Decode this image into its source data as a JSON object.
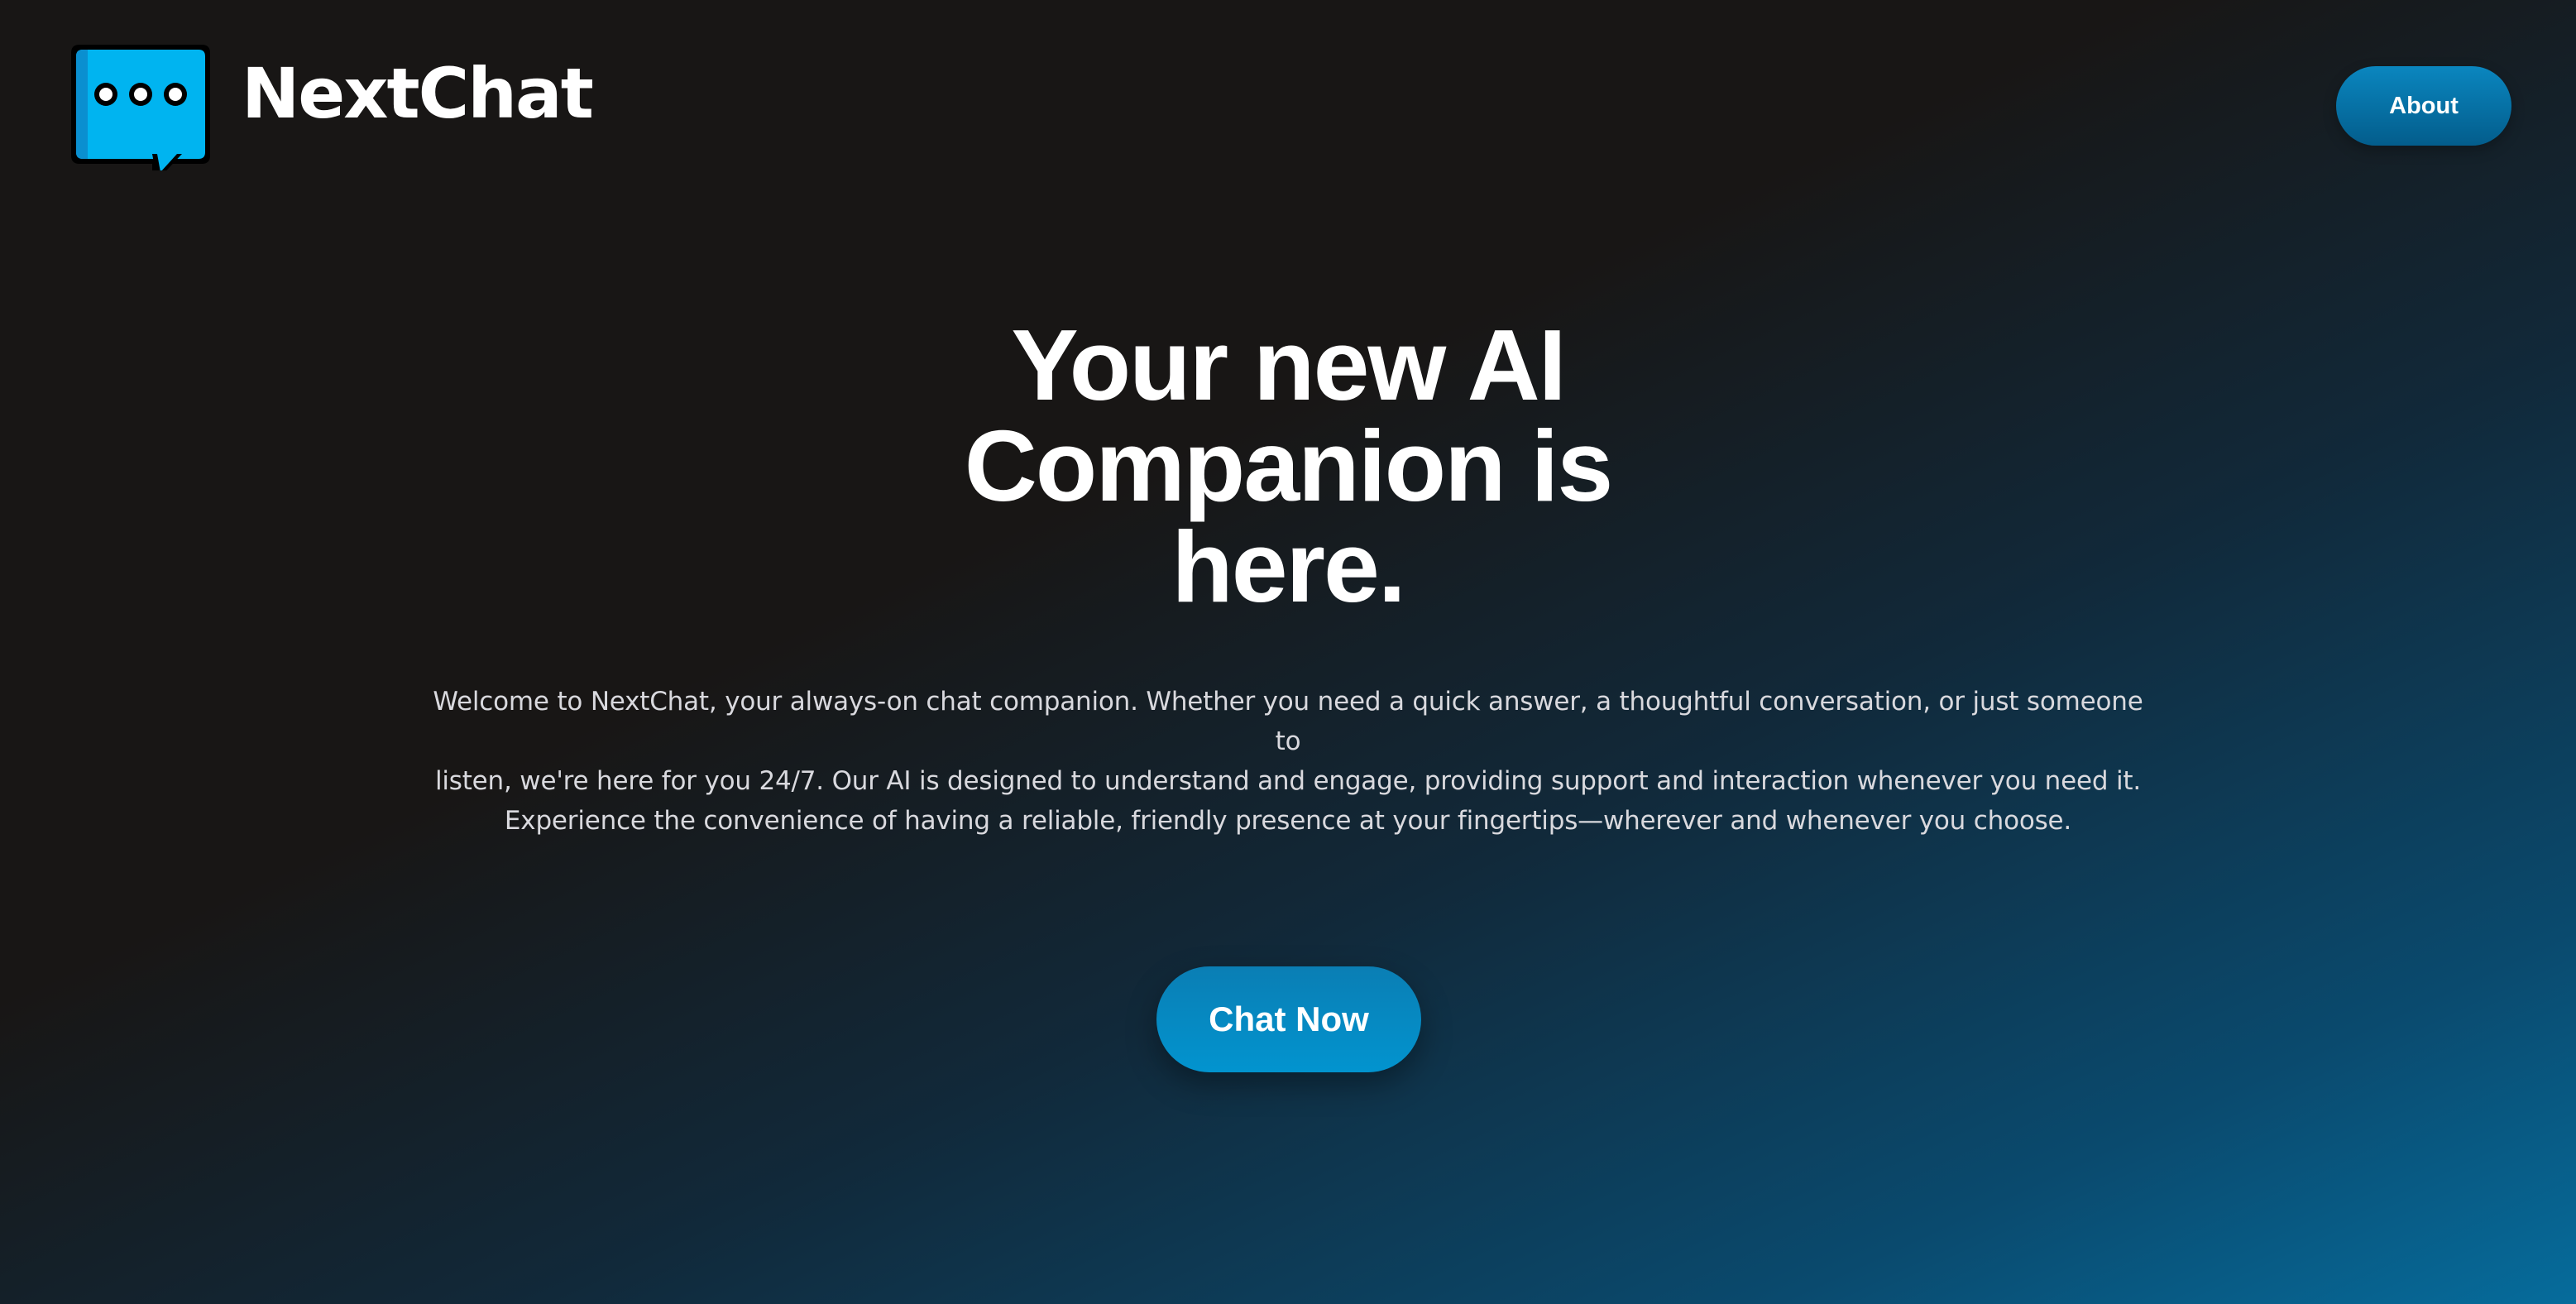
{
  "header": {
    "brand": "NextChat",
    "logo_icon": "chat-bubble-icon",
    "nav": {
      "about_label": "About"
    }
  },
  "hero": {
    "title_lines": [
      "Your new AI",
      "Companion is",
      "here."
    ],
    "description_lines": [
      "Welcome to NextChat, your always-on chat companion. Whether you need a quick answer, a thoughtful conversation, or just someone to",
      "listen, we're here for you 24/7. Our AI is designed to understand and engage, providing support and interaction whenever you need it.",
      "Experience the convenience of having a reliable, friendly presence at your fingertips—wherever and whenever you choose."
    ],
    "cta_label": "Chat Now"
  },
  "colors": {
    "background_dark": "#181615",
    "background_accent": "#066c9c",
    "accent": "#0294cf",
    "logo_blue": "#00b4f0"
  }
}
